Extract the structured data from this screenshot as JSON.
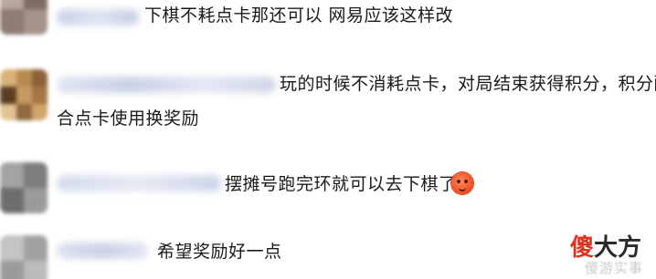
{
  "comments": [
    {
      "text_lines": [
        "下棋不耗点卡那还可以 网易应该这样改"
      ]
    },
    {
      "text_lines": [
        "玩的时候不消耗点卡，对局结束获得积分，积分配",
        "合点卡使用换奖励"
      ]
    },
    {
      "text_lines": [
        "摆摊号跑完环就可以去下棋了"
      ],
      "emoji": "angry-face-icon"
    },
    {
      "text_lines": [
        "希望奖励好一点"
      ]
    }
  ],
  "watermark": {
    "main_a": "傻",
    "main_b": "大方",
    "sub": "傻游实事"
  },
  "colors": {
    "watermark_red": "#e0301e",
    "text": "#1a1a1a"
  }
}
